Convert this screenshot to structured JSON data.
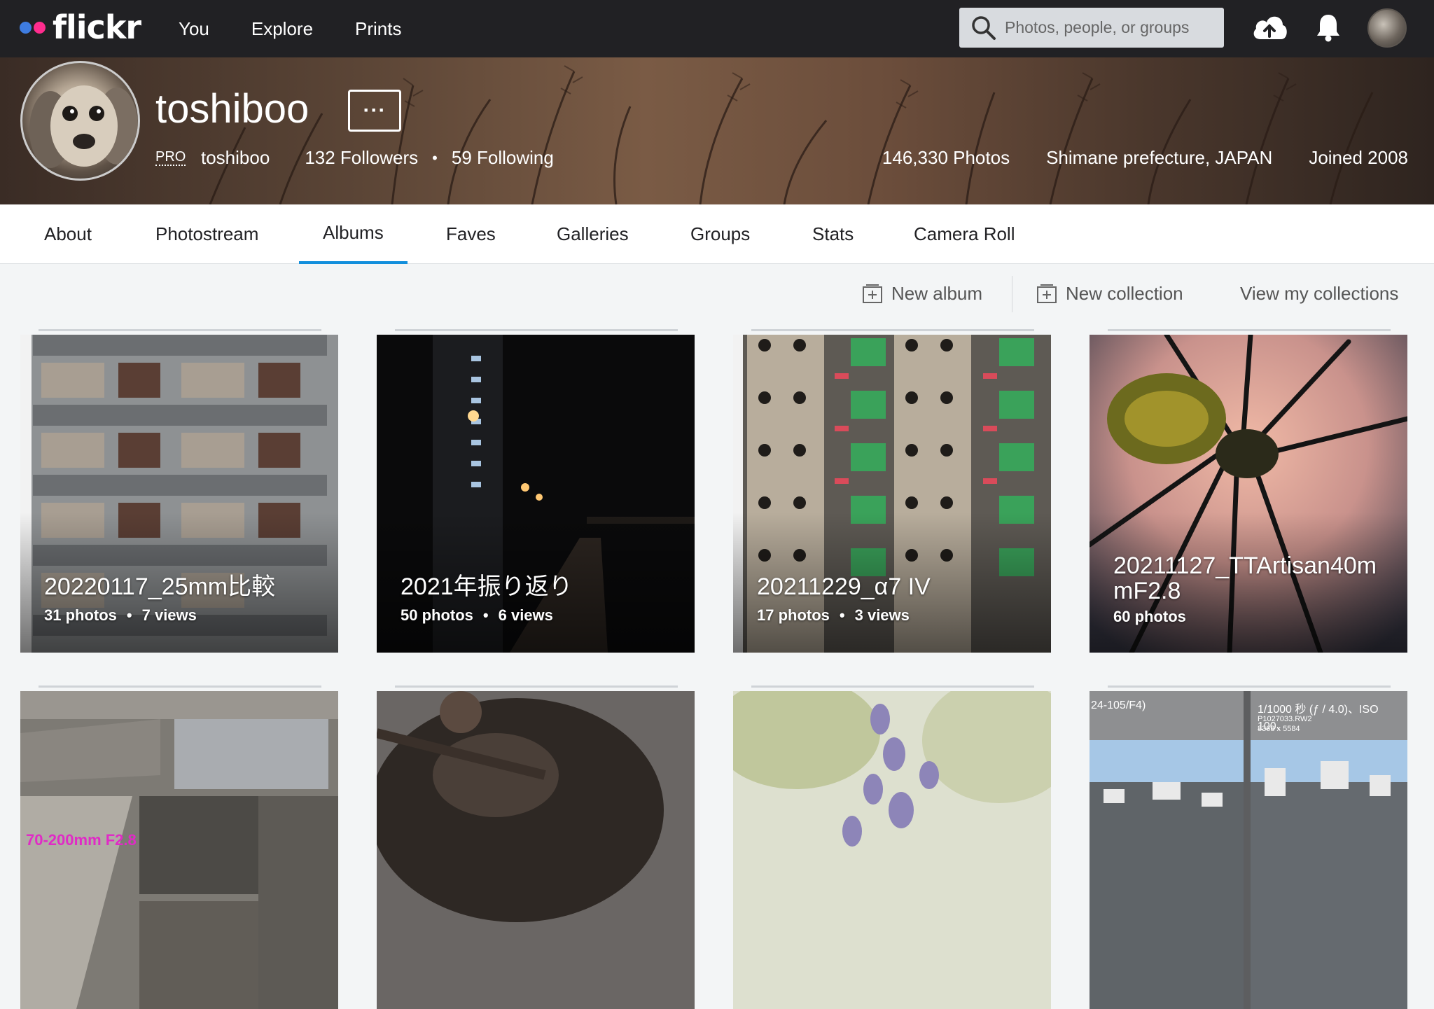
{
  "nav": {
    "logo": "flickr",
    "links": [
      "You",
      "Explore",
      "Prints"
    ],
    "search_placeholder": "Photos, people, or groups"
  },
  "profile": {
    "username": "toshiboo",
    "more": "···",
    "pro_badge": "PRO",
    "display_name": "toshiboo",
    "followers": "132 Followers",
    "following": "59 Following",
    "photos": "146,330 Photos",
    "location": "Shimane prefecture, JAPAN",
    "joined": "Joined 2008"
  },
  "tabs": [
    "About",
    "Photostream",
    "Albums",
    "Faves",
    "Galleries",
    "Groups",
    "Stats",
    "Camera Roll"
  ],
  "active_tab": "Albums",
  "toolbar": {
    "new_album": "New album",
    "new_collection": "New collection",
    "view_collections": "View my collections"
  },
  "albums": [
    {
      "title": "20220117_25mm比較",
      "photos": "31 photos",
      "views": "7 views"
    },
    {
      "title": "2021年振り返り",
      "photos": "50 photos",
      "views": "6 views"
    },
    {
      "title": "20211229_α7 IV",
      "photos": "17 photos",
      "views": "3 views"
    },
    {
      "title": "20211127_TTArtisan40mmF2.8",
      "title_line1": "20211127_TTArtisan40m",
      "title_line2": "mF2.8",
      "photos": "60 photos"
    },
    {
      "overlay_text": "70-200mm F2.8"
    },
    {},
    {},
    {
      "overlay_text_left": "24-105/F4)",
      "overlay_text_right": "1/1000 秒 (ƒ / 4.0)、ISO 100、",
      "overlay_file": "P1027033.RW2",
      "overlay_size": "8368 x 5584"
    }
  ],
  "colors": {
    "topbar": "#212124",
    "accent": "#128fdc",
    "logo_blue": "#3e7ce0",
    "logo_pink": "#ff2c8e"
  }
}
